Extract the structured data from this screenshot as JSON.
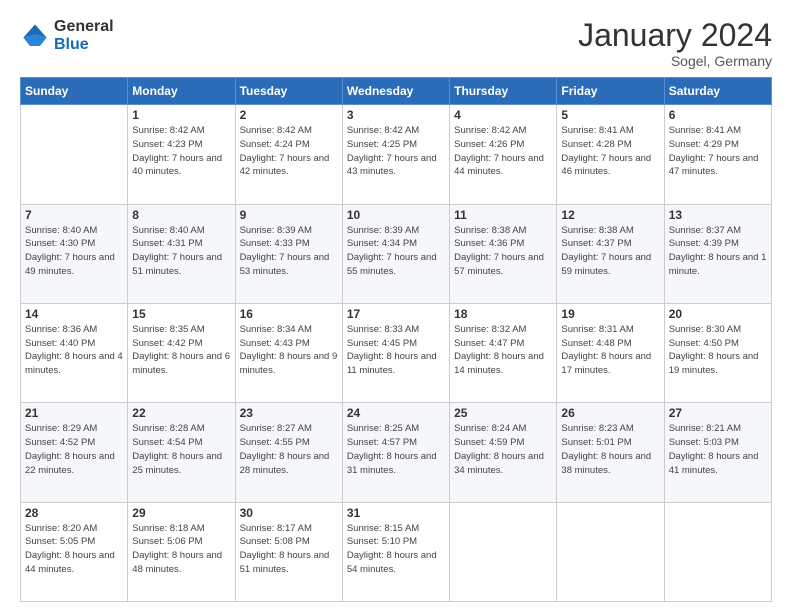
{
  "logo": {
    "general": "General",
    "blue": "Blue"
  },
  "header": {
    "title": "January 2024",
    "subtitle": "Sogel, Germany"
  },
  "days_of_week": [
    "Sunday",
    "Monday",
    "Tuesday",
    "Wednesday",
    "Thursday",
    "Friday",
    "Saturday"
  ],
  "weeks": [
    [
      {
        "day": "",
        "sunrise": "",
        "sunset": "",
        "daylight": ""
      },
      {
        "day": "1",
        "sunrise": "Sunrise: 8:42 AM",
        "sunset": "Sunset: 4:23 PM",
        "daylight": "Daylight: 7 hours and 40 minutes."
      },
      {
        "day": "2",
        "sunrise": "Sunrise: 8:42 AM",
        "sunset": "Sunset: 4:24 PM",
        "daylight": "Daylight: 7 hours and 42 minutes."
      },
      {
        "day": "3",
        "sunrise": "Sunrise: 8:42 AM",
        "sunset": "Sunset: 4:25 PM",
        "daylight": "Daylight: 7 hours and 43 minutes."
      },
      {
        "day": "4",
        "sunrise": "Sunrise: 8:42 AM",
        "sunset": "Sunset: 4:26 PM",
        "daylight": "Daylight: 7 hours and 44 minutes."
      },
      {
        "day": "5",
        "sunrise": "Sunrise: 8:41 AM",
        "sunset": "Sunset: 4:28 PM",
        "daylight": "Daylight: 7 hours and 46 minutes."
      },
      {
        "day": "6",
        "sunrise": "Sunrise: 8:41 AM",
        "sunset": "Sunset: 4:29 PM",
        "daylight": "Daylight: 7 hours and 47 minutes."
      }
    ],
    [
      {
        "day": "7",
        "sunrise": "Sunrise: 8:40 AM",
        "sunset": "Sunset: 4:30 PM",
        "daylight": "Daylight: 7 hours and 49 minutes."
      },
      {
        "day": "8",
        "sunrise": "Sunrise: 8:40 AM",
        "sunset": "Sunset: 4:31 PM",
        "daylight": "Daylight: 7 hours and 51 minutes."
      },
      {
        "day": "9",
        "sunrise": "Sunrise: 8:39 AM",
        "sunset": "Sunset: 4:33 PM",
        "daylight": "Daylight: 7 hours and 53 minutes."
      },
      {
        "day": "10",
        "sunrise": "Sunrise: 8:39 AM",
        "sunset": "Sunset: 4:34 PM",
        "daylight": "Daylight: 7 hours and 55 minutes."
      },
      {
        "day": "11",
        "sunrise": "Sunrise: 8:38 AM",
        "sunset": "Sunset: 4:36 PM",
        "daylight": "Daylight: 7 hours and 57 minutes."
      },
      {
        "day": "12",
        "sunrise": "Sunrise: 8:38 AM",
        "sunset": "Sunset: 4:37 PM",
        "daylight": "Daylight: 7 hours and 59 minutes."
      },
      {
        "day": "13",
        "sunrise": "Sunrise: 8:37 AM",
        "sunset": "Sunset: 4:39 PM",
        "daylight": "Daylight: 8 hours and 1 minute."
      }
    ],
    [
      {
        "day": "14",
        "sunrise": "Sunrise: 8:36 AM",
        "sunset": "Sunset: 4:40 PM",
        "daylight": "Daylight: 8 hours and 4 minutes."
      },
      {
        "day": "15",
        "sunrise": "Sunrise: 8:35 AM",
        "sunset": "Sunset: 4:42 PM",
        "daylight": "Daylight: 8 hours and 6 minutes."
      },
      {
        "day": "16",
        "sunrise": "Sunrise: 8:34 AM",
        "sunset": "Sunset: 4:43 PM",
        "daylight": "Daylight: 8 hours and 9 minutes."
      },
      {
        "day": "17",
        "sunrise": "Sunrise: 8:33 AM",
        "sunset": "Sunset: 4:45 PM",
        "daylight": "Daylight: 8 hours and 11 minutes."
      },
      {
        "day": "18",
        "sunrise": "Sunrise: 8:32 AM",
        "sunset": "Sunset: 4:47 PM",
        "daylight": "Daylight: 8 hours and 14 minutes."
      },
      {
        "day": "19",
        "sunrise": "Sunrise: 8:31 AM",
        "sunset": "Sunset: 4:48 PM",
        "daylight": "Daylight: 8 hours and 17 minutes."
      },
      {
        "day": "20",
        "sunrise": "Sunrise: 8:30 AM",
        "sunset": "Sunset: 4:50 PM",
        "daylight": "Daylight: 8 hours and 19 minutes."
      }
    ],
    [
      {
        "day": "21",
        "sunrise": "Sunrise: 8:29 AM",
        "sunset": "Sunset: 4:52 PM",
        "daylight": "Daylight: 8 hours and 22 minutes."
      },
      {
        "day": "22",
        "sunrise": "Sunrise: 8:28 AM",
        "sunset": "Sunset: 4:54 PM",
        "daylight": "Daylight: 8 hours and 25 minutes."
      },
      {
        "day": "23",
        "sunrise": "Sunrise: 8:27 AM",
        "sunset": "Sunset: 4:55 PM",
        "daylight": "Daylight: 8 hours and 28 minutes."
      },
      {
        "day": "24",
        "sunrise": "Sunrise: 8:25 AM",
        "sunset": "Sunset: 4:57 PM",
        "daylight": "Daylight: 8 hours and 31 minutes."
      },
      {
        "day": "25",
        "sunrise": "Sunrise: 8:24 AM",
        "sunset": "Sunset: 4:59 PM",
        "daylight": "Daylight: 8 hours and 34 minutes."
      },
      {
        "day": "26",
        "sunrise": "Sunrise: 8:23 AM",
        "sunset": "Sunset: 5:01 PM",
        "daylight": "Daylight: 8 hours and 38 minutes."
      },
      {
        "day": "27",
        "sunrise": "Sunrise: 8:21 AM",
        "sunset": "Sunset: 5:03 PM",
        "daylight": "Daylight: 8 hours and 41 minutes."
      }
    ],
    [
      {
        "day": "28",
        "sunrise": "Sunrise: 8:20 AM",
        "sunset": "Sunset: 5:05 PM",
        "daylight": "Daylight: 8 hours and 44 minutes."
      },
      {
        "day": "29",
        "sunrise": "Sunrise: 8:18 AM",
        "sunset": "Sunset: 5:06 PM",
        "daylight": "Daylight: 8 hours and 48 minutes."
      },
      {
        "day": "30",
        "sunrise": "Sunrise: 8:17 AM",
        "sunset": "Sunset: 5:08 PM",
        "daylight": "Daylight: 8 hours and 51 minutes."
      },
      {
        "day": "31",
        "sunrise": "Sunrise: 8:15 AM",
        "sunset": "Sunset: 5:10 PM",
        "daylight": "Daylight: 8 hours and 54 minutes."
      },
      {
        "day": "",
        "sunrise": "",
        "sunset": "",
        "daylight": ""
      },
      {
        "day": "",
        "sunrise": "",
        "sunset": "",
        "daylight": ""
      },
      {
        "day": "",
        "sunrise": "",
        "sunset": "",
        "daylight": ""
      }
    ]
  ]
}
